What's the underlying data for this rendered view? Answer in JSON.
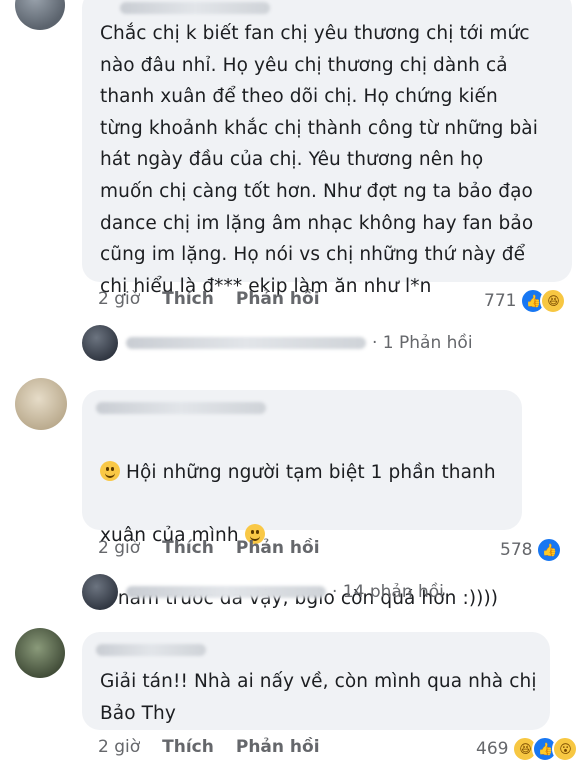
{
  "comments": [
    {
      "text": "Chắc chị k biết fan chị yêu thương chị tới mức\nnào đâu nhỉ. Họ yêu chị thương chị dành cả\nthanh xuân để theo dõi chị. Họ chứng kiến\ntừng khoảnh khắc chị thành công từ những bài\nhát ngày đầu của chị. Yêu thương nên họ\nmuốn chị càng tốt hơn. Như đợt ng ta bảo đạo\ndance chị im lặng âm nhạc không hay fan bảo\ncũng im lặng. Họ nói vs chị những thứ này để\nchị hiểu là đ*** ekip làm ăn như l*n",
      "time": "2 giờ",
      "like_label": "Thích",
      "reply_label": "Phản hồi",
      "reaction_count": "771",
      "replies": "· 1 Phản hồi"
    },
    {
      "line1": "Hội những người tạm biệt 1 phần thanh",
      "line2": "xuân của mình",
      "line3": "4 năm trước đã vậy, bgio còn quá hơn :))))",
      "time": "2 giờ",
      "like_label": "Thích",
      "reply_label": "Phản hồi",
      "reaction_count": "578",
      "replies": "· 14 phản hồi"
    },
    {
      "text": "Giải tán!! Nhà ai nấy về, còn mình qua nhà chị\nBảo Thy",
      "time": "2 giờ",
      "like_label": "Thích",
      "reply_label": "Phản hồi",
      "reaction_count": "469"
    }
  ],
  "colors": {
    "bubble": "#f0f2f5",
    "meta_text": "#65676b",
    "like_blue": "#1877f2",
    "haha_yellow": "#f7c742"
  }
}
